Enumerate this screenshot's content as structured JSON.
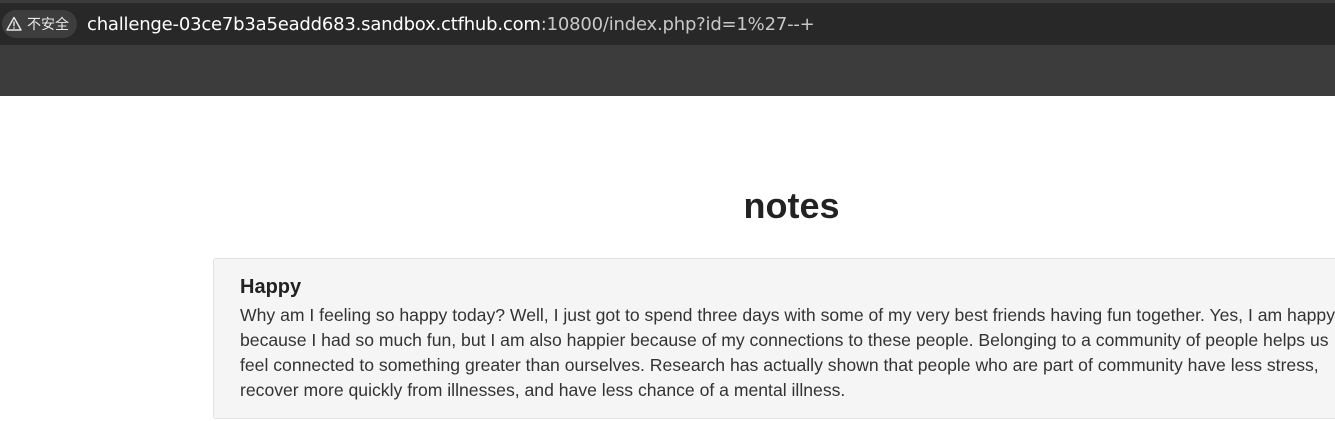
{
  "browser": {
    "security_label": "不安全",
    "url_host": "challenge-03ce7b3a5eadd683.sandbox.ctfhub.com",
    "url_rest": ":10800/index.php?id=1%27--+"
  },
  "page": {
    "title": "notes",
    "notes": [
      {
        "title": "Happy",
        "body": "Why am I feeling so happy today? Well, I just got to spend three days with some of my very best friends having fun together. Yes, I am happy because I had so much fun, but I am also happier because of my connections to these people. Belonging to a community of people helps us feel connected to something greater than ourselves. Research has actually shown that people who are part of community have less stress, recover more quickly from illnesses, and have less chance of a mental illness."
      }
    ]
  },
  "icons": {
    "security": "warning-triangle-icon"
  },
  "colors": {
    "chrome_bg": "#3c3c3c",
    "address_bg": "#282828",
    "card_bg": "#f5f5f5",
    "title_text": "#222222"
  }
}
